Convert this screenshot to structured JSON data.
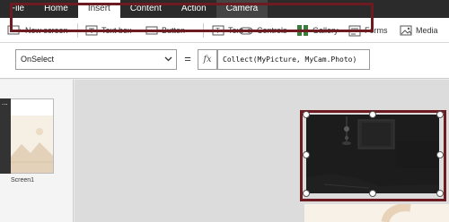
{
  "menu": {
    "tabs": [
      "File",
      "Home",
      "Insert",
      "Content",
      "Action",
      "Camera"
    ],
    "active": "Insert"
  },
  "ribbon": {
    "new_screen": "New screen",
    "text_box": "Text box",
    "button": "Button",
    "text": "Text",
    "controls": "Controls",
    "gallery": "Gallery",
    "forms": "Forms",
    "media": "Media"
  },
  "formula_bar": {
    "property": "OnSelect",
    "equals": "=",
    "fx": "fx",
    "formula": "Collect(MyPicture, MyCam.Photo)"
  },
  "screens": {
    "thumbnail_label": "Screen1",
    "menu_dots": "..."
  },
  "colors": {
    "highlight_frame": "#6d1a20",
    "menubar_bg": "#2b2b2b",
    "camera_tab_bg": "#444444"
  }
}
